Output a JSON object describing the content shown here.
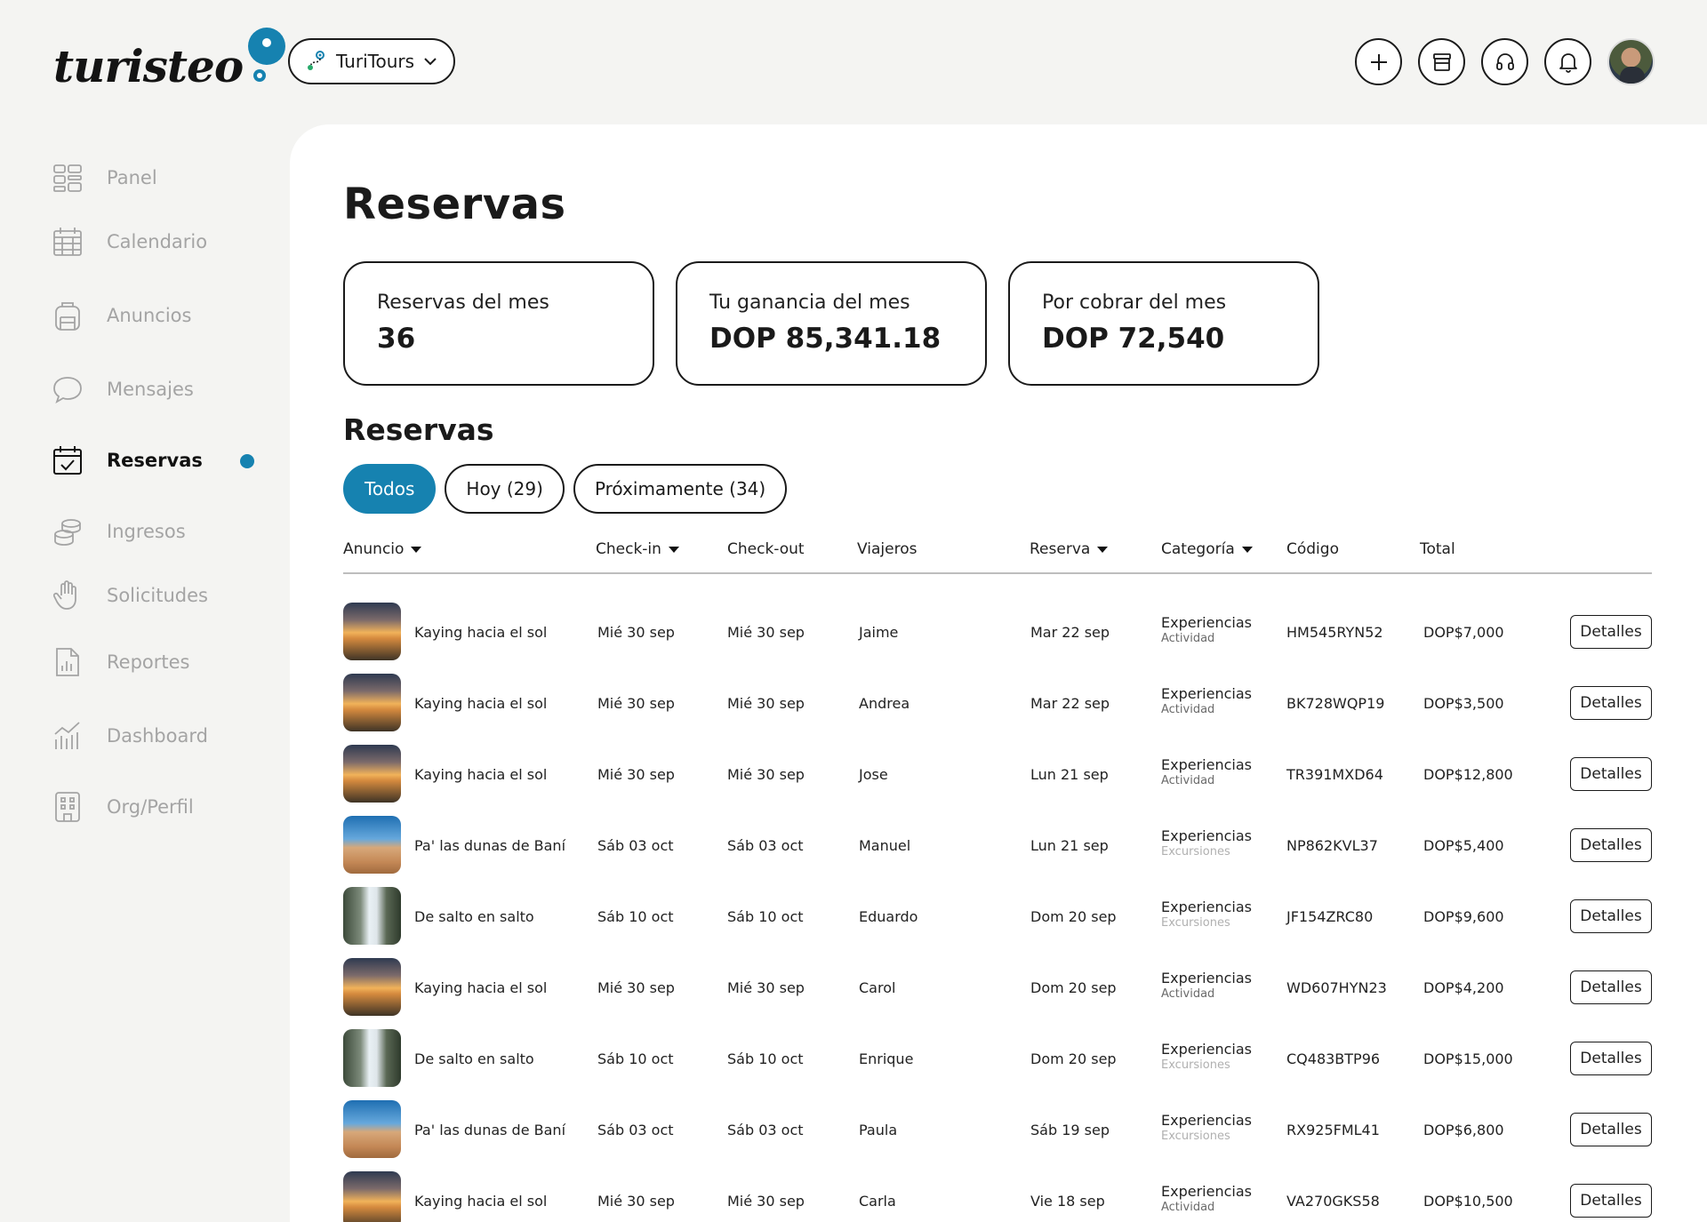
{
  "app": {
    "logo_text": "turisteo"
  },
  "company": {
    "name": "TuriTours"
  },
  "sidebar": {
    "items": [
      {
        "label": "Panel",
        "icon": "grid-icon"
      },
      {
        "label": "Calendario",
        "icon": "calendar-icon"
      },
      {
        "label": "Anuncios",
        "icon": "backpack-icon"
      },
      {
        "label": "Mensajes",
        "icon": "chat-icon"
      },
      {
        "label": "Reservas",
        "icon": "calendar-check-icon",
        "active": true
      },
      {
        "label": "Ingresos",
        "icon": "coins-icon"
      },
      {
        "label": "Solicitudes",
        "icon": "hand-icon"
      },
      {
        "label": "Reportes",
        "icon": "report-icon"
      },
      {
        "label": "Dashboard",
        "icon": "chart-icon"
      },
      {
        "label": "Org/Perfil",
        "icon": "building-icon"
      }
    ]
  },
  "page": {
    "title": "Reservas",
    "section_title": "Reservas"
  },
  "stats": [
    {
      "label": "Reservas del mes",
      "value": "36"
    },
    {
      "label": "Tu ganancia del mes",
      "value": "DOP 85,341.18"
    },
    {
      "label": "Por cobrar del mes",
      "value": "DOP 72,540"
    }
  ],
  "filters": [
    {
      "label": "Todos",
      "active": true
    },
    {
      "label": "Hoy (29)"
    },
    {
      "label": "Próximamente (34)"
    }
  ],
  "table": {
    "columns": [
      "Anuncio",
      "Check-in",
      "Check-out",
      "Viajeros",
      "Reserva",
      "Categoría",
      "Código",
      "Total"
    ],
    "details_label": "Detalles",
    "rows": [
      {
        "anuncio": "Kaying hacia el sol",
        "thumb": "sunset",
        "checkin": "Mié 30 sep",
        "checkout": "Mié 30 sep",
        "viajero": "Jaime",
        "reserva": "Mar 22 sep",
        "categoria": "Experiencias",
        "subcategoria": "Actividad",
        "codigo": "HM545RYN52",
        "total": "DOP$7,000"
      },
      {
        "anuncio": "Kaying hacia el sol",
        "thumb": "sunset",
        "checkin": "Mié 30 sep",
        "checkout": "Mié 30 sep",
        "viajero": "Andrea",
        "reserva": "Mar 22 sep",
        "categoria": "Experiencias",
        "subcategoria": "Actividad",
        "codigo": "BK728WQP19",
        "total": "DOP$3,500"
      },
      {
        "anuncio": "Kaying hacia el sol",
        "thumb": "sunset",
        "checkin": "Mié 30 sep",
        "checkout": "Mié 30 sep",
        "viajero": "Jose",
        "reserva": "Lun 21 sep",
        "categoria": "Experiencias",
        "subcategoria": "Actividad",
        "codigo": "TR391MXD64",
        "total": "DOP$12,800"
      },
      {
        "anuncio": "Pa' las dunas de Baní",
        "thumb": "dunes",
        "checkin": "Sáb 03 oct",
        "checkout": "Sáb 03 oct",
        "viajero": "Manuel",
        "reserva": "Lun 21 sep",
        "categoria": "Experiencias",
        "subcategoria": "Excursiones",
        "codigo": "NP862KVL37",
        "total": "DOP$5,400"
      },
      {
        "anuncio": "De salto en salto",
        "thumb": "falls",
        "checkin": "Sáb 10 oct",
        "checkout": "Sáb 10 oct",
        "viajero": "Eduardo",
        "reserva": "Dom 20 sep",
        "categoria": "Experiencias",
        "subcategoria": "Excursiones",
        "codigo": "JF154ZRC80",
        "total": "DOP$9,600"
      },
      {
        "anuncio": "Kaying hacia el sol",
        "thumb": "sunset",
        "checkin": "Mié 30 sep",
        "checkout": "Mié 30 sep",
        "viajero": "Carol",
        "reserva": "Dom 20 sep",
        "categoria": "Experiencias",
        "subcategoria": "Actividad",
        "codigo": "WD607HYN23",
        "total": "DOP$4,200"
      },
      {
        "anuncio": "De salto en salto",
        "thumb": "falls",
        "checkin": "Sáb 10 oct",
        "checkout": "Sáb 10 oct",
        "viajero": "Enrique",
        "reserva": "Dom 20 sep",
        "categoria": "Experiencias",
        "subcategoria": "Excursiones",
        "codigo": "CQ483BTP96",
        "total": "DOP$15,000"
      },
      {
        "anuncio": "Pa' las dunas de Baní",
        "thumb": "dunes",
        "checkin": "Sáb 03 oct",
        "checkout": "Sáb 03 oct",
        "viajero": "Paula",
        "reserva": "Sáb 19 sep",
        "categoria": "Experiencias",
        "subcategoria": "Excursiones",
        "codigo": "RX925FML41",
        "total": "DOP$6,800"
      },
      {
        "anuncio": "Kaying hacia el sol",
        "thumb": "sunset",
        "checkin": "Mié 30 sep",
        "checkout": "Mié 30 sep",
        "viajero": "Carla",
        "reserva": "Vie 18 sep",
        "categoria": "Experiencias",
        "subcategoria": "Actividad",
        "codigo": "VA270GKS58",
        "total": "DOP$10,500"
      }
    ]
  },
  "colors": {
    "accent": "#1682b0",
    "background": "#f4f4f2",
    "panel": "#ffffff"
  }
}
